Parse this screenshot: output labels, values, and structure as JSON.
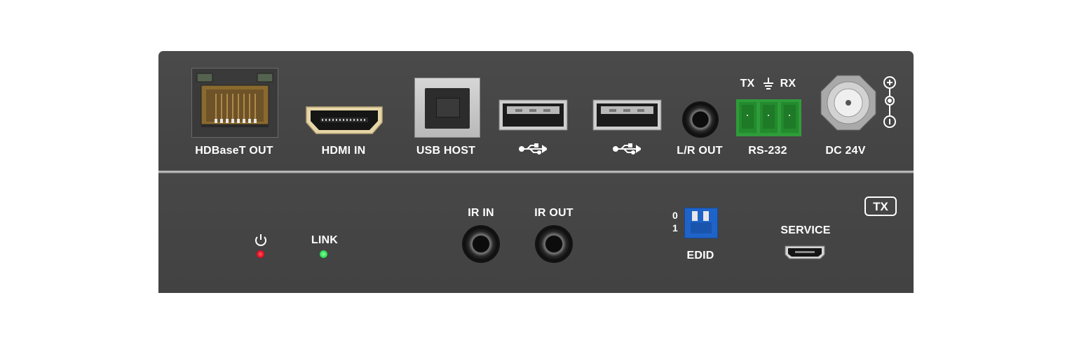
{
  "rear_panel": {
    "hdbaset_label": "HDBaseT OUT",
    "hdmi_label": "HDMI IN",
    "usb_host_label": "USB HOST",
    "lr_out_label": "L/R OUT",
    "rs232_label": "RS-232",
    "rs232_tx": "TX",
    "rs232_rx": "RX",
    "dc_label": "DC 24V",
    "usb_icon": "usb-icon",
    "ground_icon": "ground-icon",
    "polarity_icon": "dc-polarity-icon"
  },
  "front_panel": {
    "power_icon": "power-icon",
    "link_label": "LINK",
    "ir_in_label": "IR IN",
    "ir_out_label": "IR OUT",
    "edid_label": "EDID",
    "edid_pos_0": "0",
    "edid_pos_1": "1",
    "service_label": "SERVICE",
    "badge": "TX"
  },
  "colors": {
    "chassis": "#464646",
    "power_led": "#e3001b",
    "link_led": "#22d64a",
    "dip_switch": "#1e63c8",
    "terminal_block": "#2f9c3a"
  }
}
